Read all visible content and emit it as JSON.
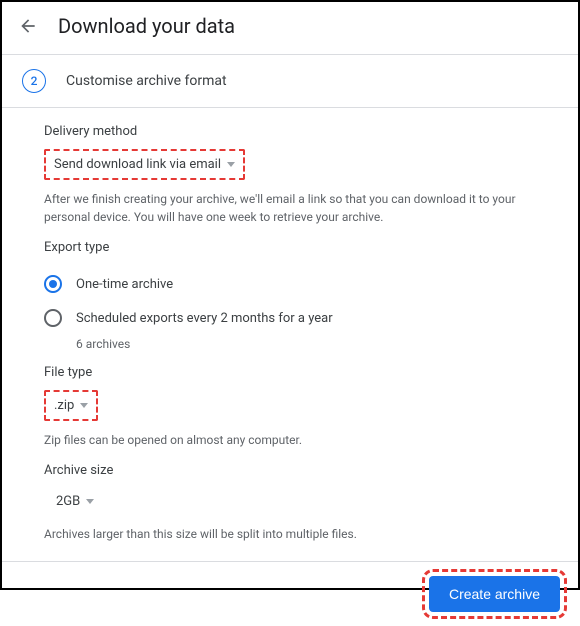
{
  "header": {
    "title": "Download your data"
  },
  "step": {
    "number": "2",
    "title": "Customise archive format"
  },
  "delivery": {
    "label": "Delivery method",
    "selected": "Send download link via email",
    "help": "After we finish creating your archive, we'll email a link so that you can download it to your personal device. You will have one week to retrieve your archive."
  },
  "export": {
    "label": "Export type",
    "options": [
      {
        "label": "One-time archive",
        "selected": true
      },
      {
        "label": "Scheduled exports every 2 months for a year",
        "selected": false,
        "sublabel": "6 archives"
      }
    ]
  },
  "filetype": {
    "label": "File type",
    "selected": ".zip",
    "help": "Zip files can be opened on almost any computer."
  },
  "archivesize": {
    "label": "Archive size",
    "selected": "2GB",
    "help": "Archives larger than this size will be split into multiple files."
  },
  "footer": {
    "create_label": "Create archive"
  }
}
